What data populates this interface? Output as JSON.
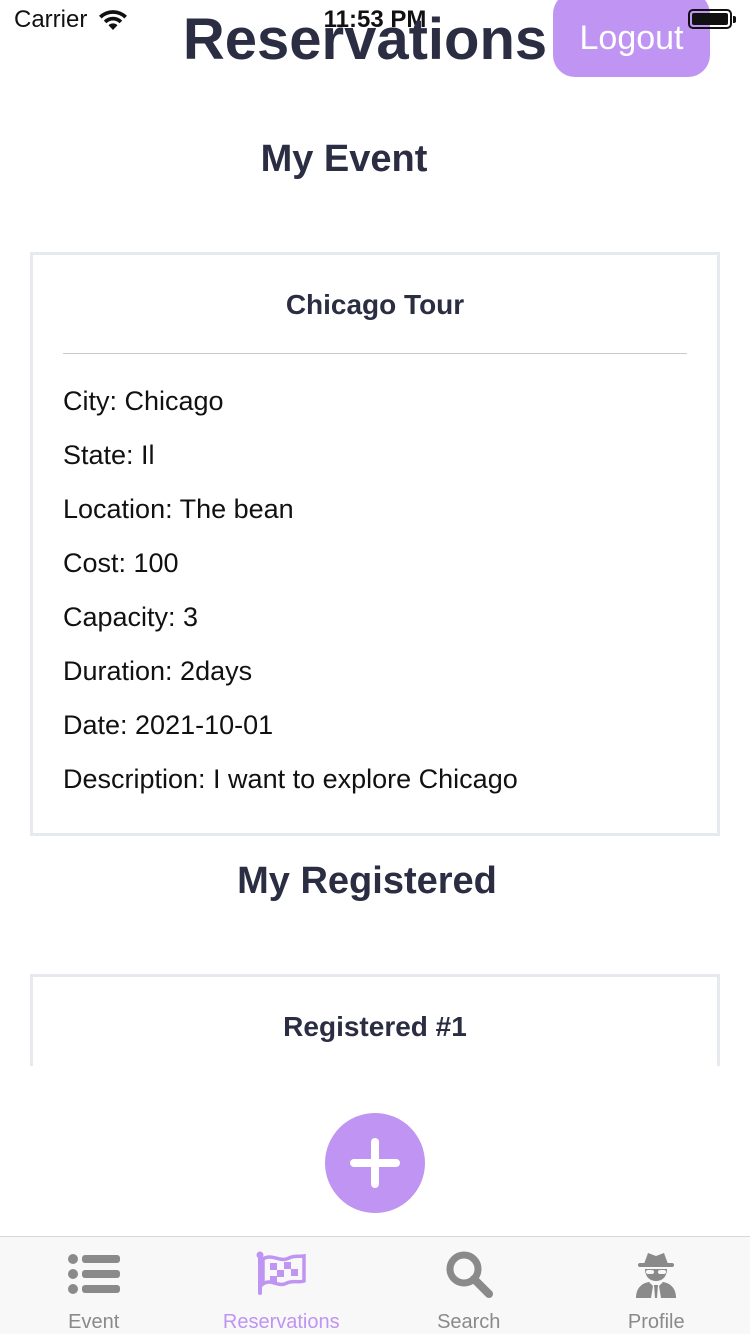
{
  "status_bar": {
    "carrier": "Carrier",
    "time": "11:53 PM"
  },
  "header": {
    "title": "Reservations",
    "logout_label": "Logout"
  },
  "my_event": {
    "section_title": "My Event",
    "card_title": "Chicago Tour",
    "details": [
      "City: Chicago",
      "State: Il",
      "Location: The bean",
      "Cost: 100",
      "Capacity: 3",
      "Duration: 2days",
      "Date: 2021-10-01",
      "Description: I want to explore Chicago"
    ]
  },
  "my_registered": {
    "section_title": "My Registered",
    "cards": [
      {
        "title": "Registered #1"
      }
    ]
  },
  "fab": {
    "icon": "plus-icon"
  },
  "tab_bar": {
    "tabs": [
      {
        "label": "Event",
        "icon": "list-icon",
        "active": false
      },
      {
        "label": "Reservations",
        "icon": "flag-icon",
        "active": true
      },
      {
        "label": "Search",
        "icon": "search-icon",
        "active": false
      },
      {
        "label": "Profile",
        "icon": "user-secret-icon",
        "active": false
      }
    ]
  },
  "colors": {
    "accent": "#bf94f2",
    "title_text": "#2b2d42",
    "inactive_tab": "#8a8a8a",
    "card_border": "#e6e9ee"
  }
}
